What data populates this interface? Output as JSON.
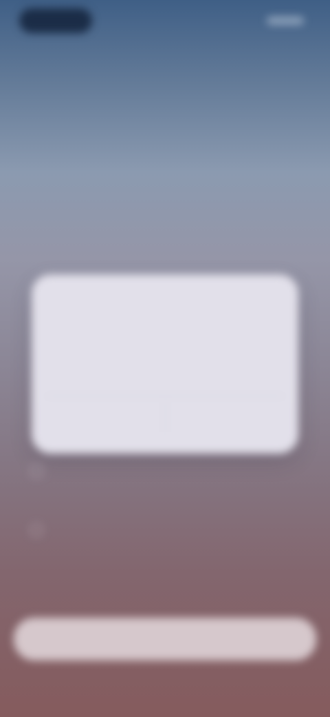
{
  "background": {
    "top_color": "#3f5f86",
    "bottom_color": "#855b5d"
  },
  "status_bar": {
    "left_pill_color": "#14243e"
  },
  "header": {
    "eyebrow": "",
    "title": ""
  },
  "dialog": {
    "heading": "",
    "body": "",
    "actions": [
      {
        "label": ""
      },
      {
        "label": ""
      }
    ],
    "background": "#e2e0ea"
  },
  "options": [
    {
      "label": "",
      "checked": false
    },
    {
      "label": "",
      "checked": false
    }
  ],
  "cta": {
    "label": "",
    "background": "#d6c8cc"
  }
}
